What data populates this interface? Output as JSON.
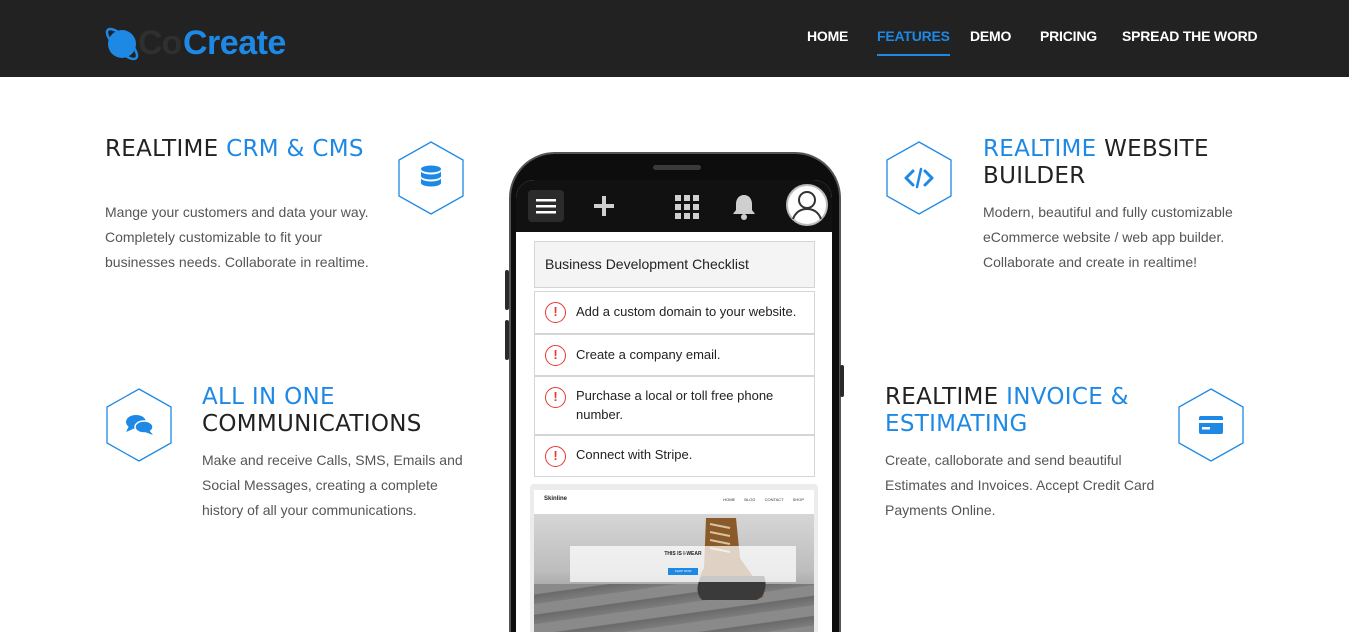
{
  "brand": {
    "co": "Co",
    "create": "Create"
  },
  "nav": {
    "items": [
      {
        "label": "HOME"
      },
      {
        "label": "FEATURES"
      },
      {
        "label": "DEMO"
      },
      {
        "label": "PRICING"
      },
      {
        "label": "SPREAD THE WORD"
      }
    ],
    "active_index": 1
  },
  "colors": {
    "accent": "#1e88e5",
    "header_bg": "#222222",
    "warn": "#e53935"
  },
  "features": {
    "crm": {
      "title_dark": "REALTIME ",
      "title_blue": "CRM & CMS",
      "desc_lines": [
        "Mange your customers and data your way.",
        "Completely customizable to fit your",
        "businesses needs. Collaborate in realtime."
      ],
      "icon": "database-icon"
    },
    "website": {
      "title_blue": "REALTIME",
      "title_dark": " WEBSITE BUILDER",
      "desc_lines": [
        "Modern, beautiful and fully customizable",
        "eCommerce website / web app builder.",
        "Collaborate and create in realtime!"
      ],
      "icon": "code-icon"
    },
    "communications": {
      "title_blue": "ALL IN ONE",
      "title_dark": "COMMUNICATIONS",
      "desc_lines": [
        "Make and receive Calls, SMS, Emails and",
        "Social Messages, creating a complete",
        "history of all your communications."
      ],
      "icon": "chat-icon"
    },
    "invoice": {
      "title_dark": "REALTIME ",
      "title_blue": "INVOICE & ESTIMATING",
      "desc_lines": [
        "Create, calloborate and send beautiful",
        "Estimates and Invoices. Accept Credit Card",
        "Payments Online."
      ],
      "icon": "credit-card-icon"
    }
  },
  "phone": {
    "checklist_title": "Business Development Checklist",
    "items": [
      "Add a custom domain to your website.",
      "Create a company email.",
      "Purchase a local or toll free phone number.",
      "Connect with Stripe."
    ],
    "warn_glyph": "!",
    "preview": {
      "brand": "Skinline",
      "links": [
        "HOME",
        "BLOG",
        "CONTACT",
        "SHOP"
      ],
      "headline": "THIS IS I-WEAR",
      "button": "SHOP NOW"
    }
  }
}
